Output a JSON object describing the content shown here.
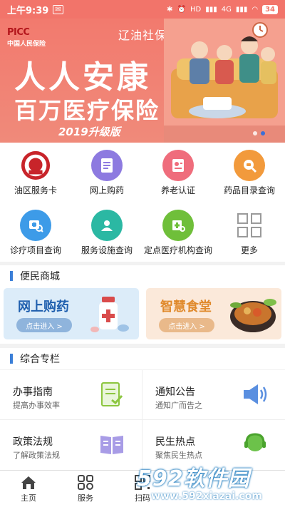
{
  "status_bar": {
    "time": "上午9:39",
    "hd_label": "HD",
    "net_label": "4G",
    "battery": "34"
  },
  "banner": {
    "logo_en": "PICC",
    "logo_cn": "中国人民保险",
    "city": "辽油社保",
    "title_line1": "人人安康",
    "title_line2": "百万医疗保险",
    "edition": "2019升级版",
    "page_count": 2,
    "active_page": 2
  },
  "services": [
    {
      "label": "油区服务卡",
      "icon": "social-security-card-icon",
      "color": "#c8242a"
    },
    {
      "label": "网上购药",
      "icon": "prescription-list-icon",
      "color": "#8d7ae0"
    },
    {
      "label": "养老认证",
      "icon": "id-badge-icon",
      "color": "#ef6d7c"
    },
    {
      "label": "药品目录查询",
      "icon": "medicine-search-icon",
      "color": "#f29a3c"
    },
    {
      "label": "诊疗项目查询",
      "icon": "clinic-search-icon",
      "color": "#3d9be8"
    },
    {
      "label": "服务设施查询",
      "icon": "facility-search-icon",
      "color": "#2bb8a3"
    },
    {
      "label": "定点医疗机构查询",
      "icon": "hospital-search-icon",
      "color": "#6fbf3a"
    },
    {
      "label": "更多",
      "icon": "more-grid-icon",
      "color": "#9a9a9a"
    }
  ],
  "mall": {
    "section_title": "便民商城",
    "cards": [
      {
        "title": "网上购药",
        "button": "点击进入 >"
      },
      {
        "title": "智慧食堂",
        "button": "点击进入 >"
      }
    ]
  },
  "column": {
    "section_title": "综合专栏",
    "items": [
      {
        "title": "办事指南",
        "sub": "提高办事效率",
        "icon": "guide-document-icon"
      },
      {
        "title": "通知公告",
        "sub": "通知广而告之",
        "icon": "speaker-icon"
      },
      {
        "title": "政策法规",
        "sub": "了解政策法规",
        "icon": "open-book-icon"
      },
      {
        "title": "民生热点",
        "sub": "聚焦民生热点",
        "icon": "headset-support-icon"
      }
    ]
  },
  "tabbar": [
    {
      "label": "主页",
      "icon": "home-icon"
    },
    {
      "label": "服务",
      "icon": "services-grid-icon"
    },
    {
      "label": "扫码",
      "icon": "qr-scan-icon"
    },
    {
      "label": "",
      "icon": ""
    },
    {
      "label": "",
      "icon": ""
    }
  ],
  "watermark": {
    "brand_num": "592",
    "brand_cn": "软件园",
    "url": "www.592xiazai.com"
  },
  "colors": {
    "banner": "#f27a6e",
    "accent_blue": "#3b7fd8",
    "mall_left_bg": "#dcecf9",
    "mall_right_bg": "#fbe9da"
  }
}
